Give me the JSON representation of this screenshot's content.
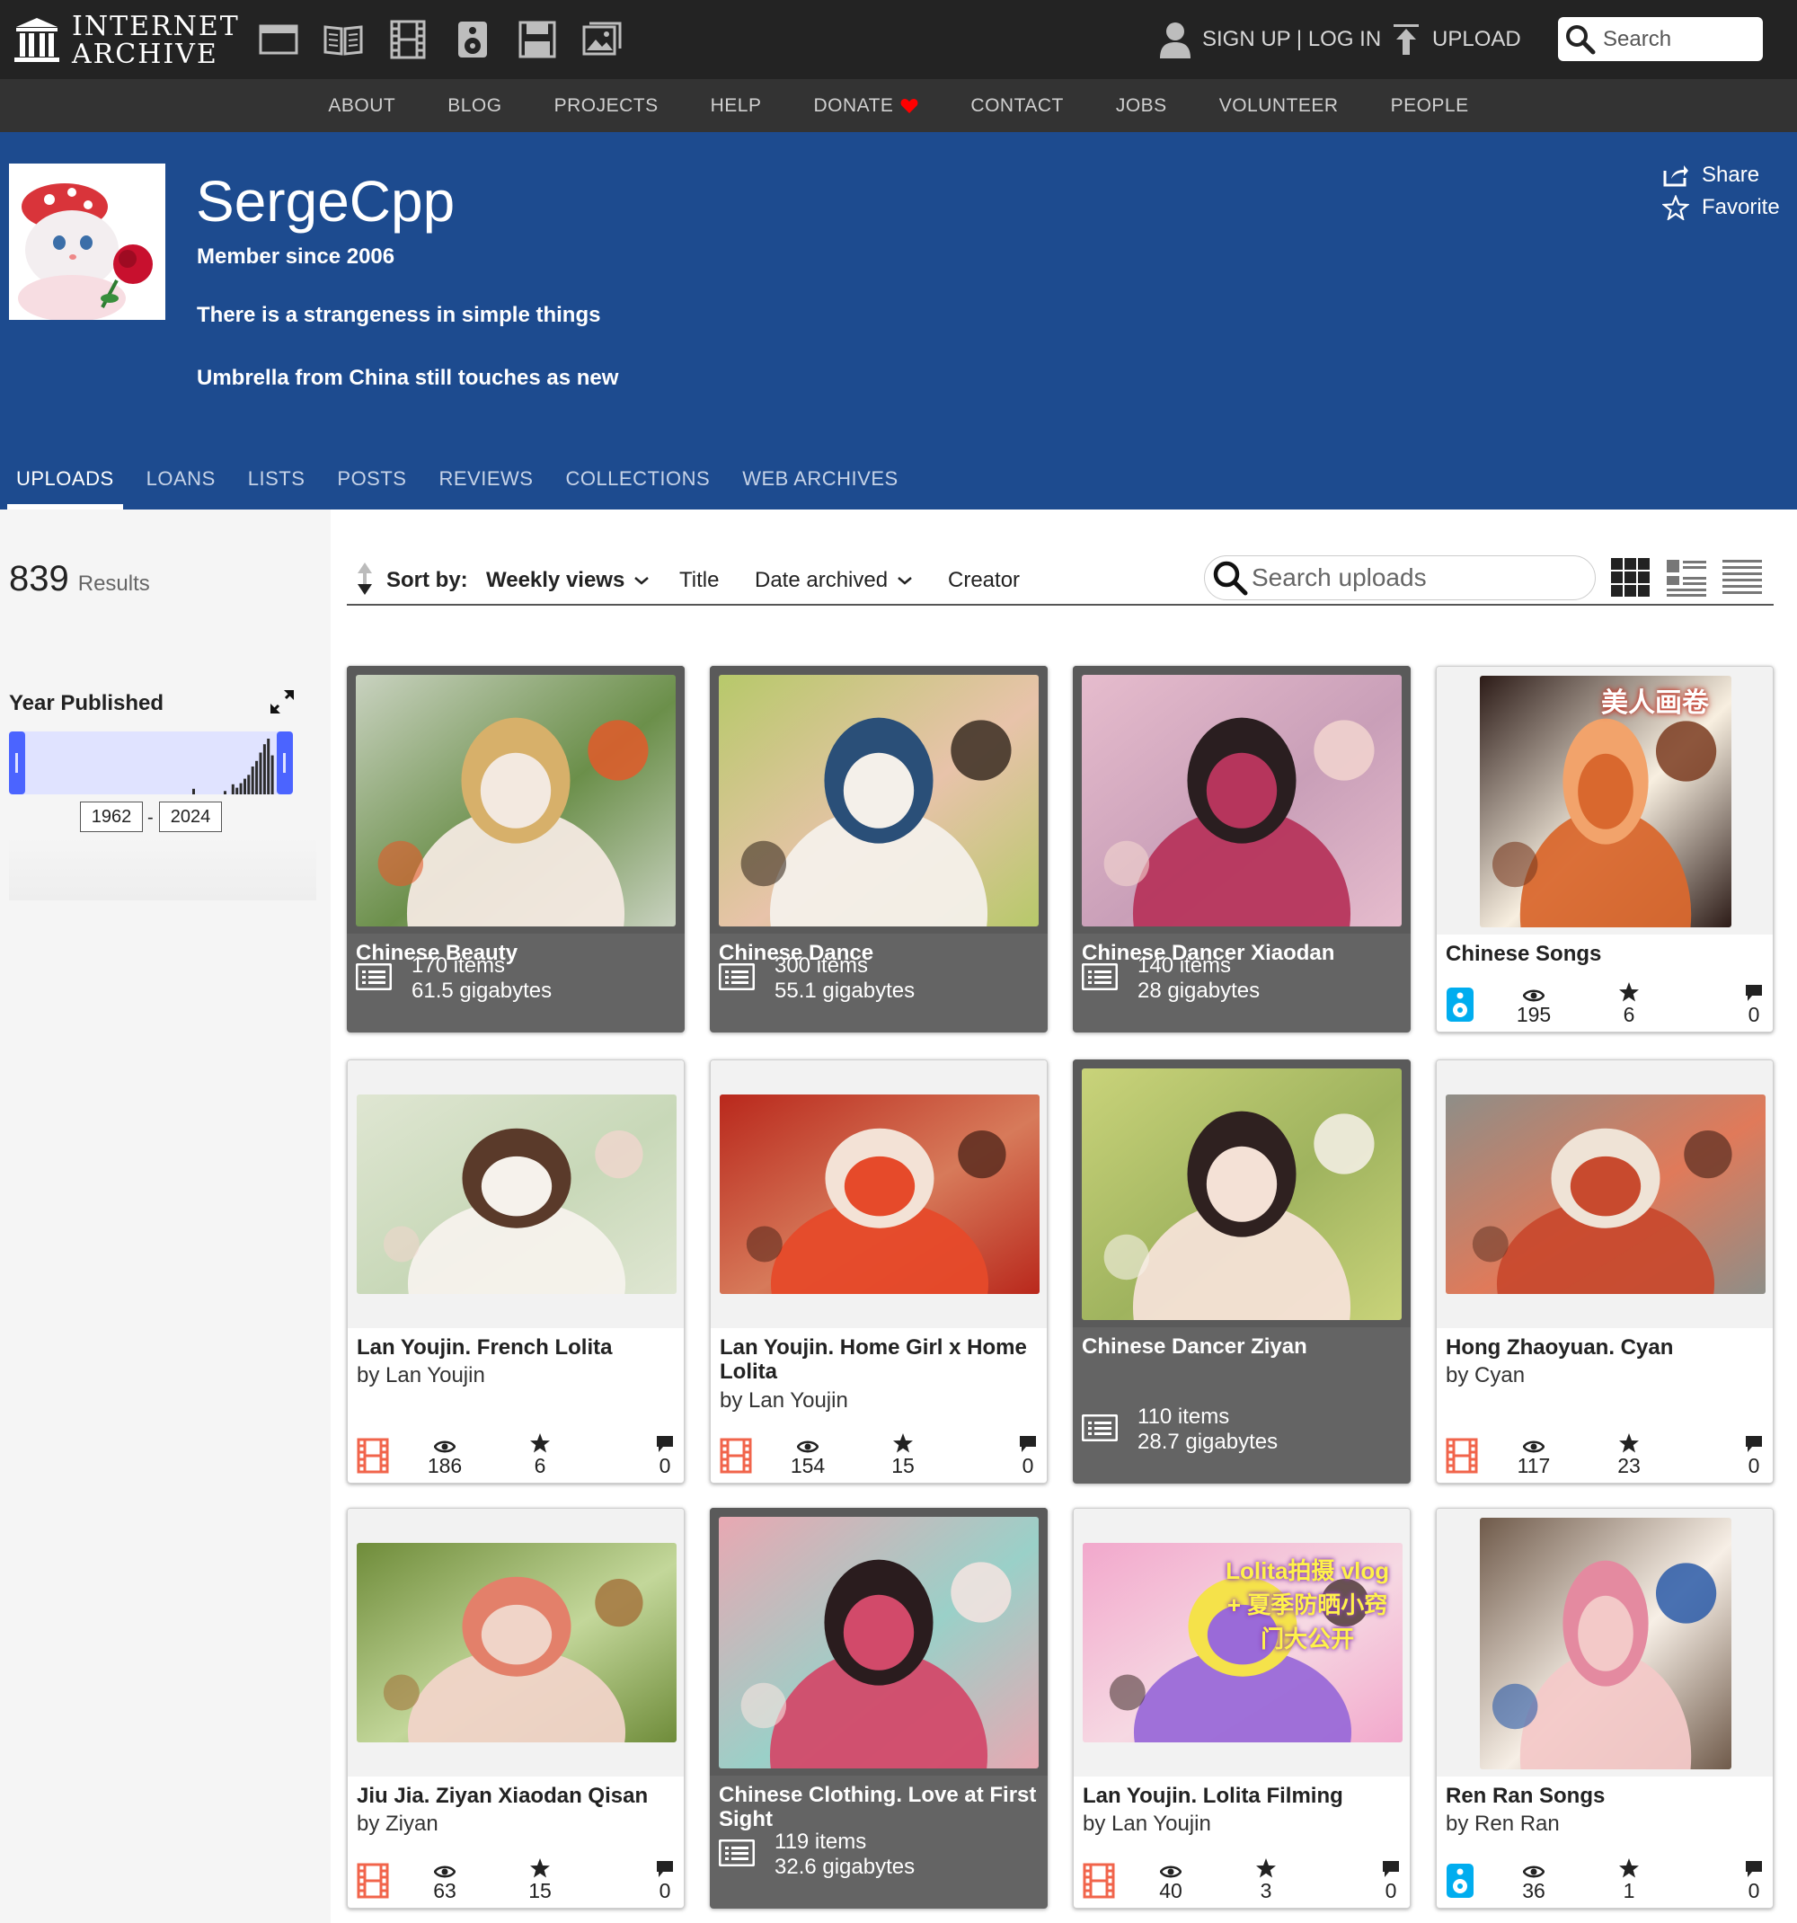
{
  "header": {
    "logo_line1": "INTERNET",
    "logo_line2": "ARCHIVE",
    "media_icons": [
      "web-icon",
      "texts-icon",
      "video-icon",
      "audio-icon",
      "software-icon",
      "images-icon"
    ],
    "signup_label": "SIGN UP | LOG IN",
    "upload_label": "UPLOAD",
    "search_placeholder": "Search"
  },
  "subnav": [
    "ABOUT",
    "BLOG",
    "PROJECTS",
    "HELP",
    "DONATE",
    "CONTACT",
    "JOBS",
    "VOLUNTEER",
    "PEOPLE"
  ],
  "profile": {
    "name": "SergeCpp",
    "member_since": "Member since 2006",
    "line1": "There is a strangeness in simple things",
    "line2": "Umbrella from China still touches as new",
    "share_label": "Share",
    "favorite_label": "Favorite",
    "banner_color": "#1d4b8f"
  },
  "tabs": [
    "UPLOADS",
    "LOANS",
    "LISTS",
    "POSTS",
    "REVIEWS",
    "COLLECTIONS",
    "WEB ARCHIVES"
  ],
  "active_tab": "UPLOADS",
  "results": {
    "count": "839",
    "label": "Results"
  },
  "facet": {
    "title": "Year Published",
    "from": "1962",
    "to": "2024",
    "histogram": [
      0,
      0,
      0,
      0,
      0,
      0,
      0,
      0,
      0,
      0,
      0,
      0,
      0,
      0,
      0,
      0,
      0,
      0,
      0,
      0,
      0,
      0,
      0,
      0,
      0,
      0,
      0,
      0,
      0,
      0,
      0,
      0,
      0,
      0,
      0,
      0,
      0,
      0,
      0,
      0,
      0,
      0,
      0.1,
      0,
      0,
      0,
      0,
      0,
      0,
      0,
      0.06,
      0,
      0.18,
      0.12,
      0.2,
      0.28,
      0.35,
      0.5,
      0.6,
      0.75,
      0.9,
      1.0,
      0.7
    ]
  },
  "sort": {
    "label": "Sort by:",
    "options": [
      "Weekly views",
      "Title",
      "Date archived",
      "Creator"
    ],
    "selected": "Weekly views",
    "search_placeholder": "Search uploads"
  },
  "tiles": [
    {
      "kind": "collection",
      "title": "Chinese Beauty",
      "items": "170 items",
      "size": "61.5 gigabytes",
      "palette": [
        "#c9d2c0",
        "#f3e9e0",
        "#d7b06a",
        "#e25a2a",
        "#6b8f4a"
      ]
    },
    {
      "kind": "collection",
      "title": "Chinese Dance",
      "items": "300 items",
      "size": "55.1 gigabytes",
      "palette": [
        "#b7c96a",
        "#f4f0ea",
        "#2a4f78",
        "#3a2d22",
        "#e8c3aa"
      ]
    },
    {
      "kind": "collection",
      "title": "Chinese Dancer Xiaodan",
      "items": "140 items",
      "size": "28 gigabytes",
      "palette": [
        "#e6bccd",
        "#b6355c",
        "#2a1e20",
        "#f2d5cf",
        "#c99fb8"
      ]
    },
    {
      "kind": "item",
      "media": "audio",
      "title": "Chinese Songs",
      "by": "",
      "views": "195",
      "favs": "6",
      "reviews": "0",
      "palette": [
        "#2c1b17",
        "#d9682e",
        "#f2a36b",
        "#7a3b20",
        "#f8efe0"
      ],
      "overlay_text": "美人画卷"
    },
    {
      "kind": "item",
      "media": "movies",
      "title": "Lan Youjin. French Lolita",
      "by": "by Lan Youjin",
      "views": "186",
      "favs": "6",
      "reviews": "0",
      "palette": [
        "#dfe6d2",
        "#f6f2ec",
        "#5a3a2a",
        "#efd6cc",
        "#c8d8b8"
      ]
    },
    {
      "kind": "item",
      "media": "movies",
      "title": "Lan Youjin. Home Girl x Home Lolita",
      "by": "by Lan Youjin",
      "views": "154",
      "favs": "15",
      "reviews": "0",
      "palette": [
        "#b9281c",
        "#e64a2a",
        "#f3e2d6",
        "#5b2b1e",
        "#d77a5a"
      ]
    },
    {
      "kind": "collection",
      "title": "Chinese Dancer Ziyan",
      "items": "110 items",
      "size": "28.7 gigabytes",
      "palette": [
        "#c9d37a",
        "#f4e1d6",
        "#2f2120",
        "#f7f1ea",
        "#9fb35e"
      ]
    },
    {
      "kind": "item",
      "media": "movies",
      "title": "Hong Zhaoyuan. Cyan",
      "by": "by Cyan",
      "views": "117",
      "favs": "23",
      "reviews": "0",
      "palette": [
        "#8e8e88",
        "#c84a2e",
        "#efe3d6",
        "#6d3a2a",
        "#e07a5a"
      ]
    },
    {
      "kind": "item",
      "media": "movies",
      "title": "Jiu Jia. Ziyan Xiaodan Qisan",
      "by": "by Ziyan",
      "views": "63",
      "favs": "15",
      "reviews": "0",
      "palette": [
        "#6f8c3a",
        "#f0d4c8",
        "#e3806a",
        "#a4763e",
        "#c3d79a"
      ]
    },
    {
      "kind": "collection",
      "title": "Chinese Clothing. Love at First Sight",
      "items": "119 items",
      "size": "32.6 gigabytes",
      "palette": [
        "#e8a8b2",
        "#d24a6a",
        "#2a1c1e",
        "#f6e4e0",
        "#9ad0c8"
      ]
    },
    {
      "kind": "item",
      "media": "movies",
      "title": "Lan Youjin. Lolita Filming",
      "by": "by Lan Youjin",
      "views": "40",
      "favs": "3",
      "reviews": "0",
      "palette": [
        "#f2a8cc",
        "#9a6ad8",
        "#f5e24a",
        "#4f3a38",
        "#f6d9e3"
      ],
      "overlay_text": "Lolita拍摄 vlog + 夏季防晒小窍门大公开"
    },
    {
      "kind": "item",
      "media": "audio",
      "title": "Ren Ran Songs",
      "by": "by Ren Ran",
      "views": "36",
      "favs": "1",
      "reviews": "0",
      "palette": [
        "#6f5a4a",
        "#f3c9c8",
        "#e48aa0",
        "#2a5aa8",
        "#f7efe6"
      ]
    }
  ]
}
